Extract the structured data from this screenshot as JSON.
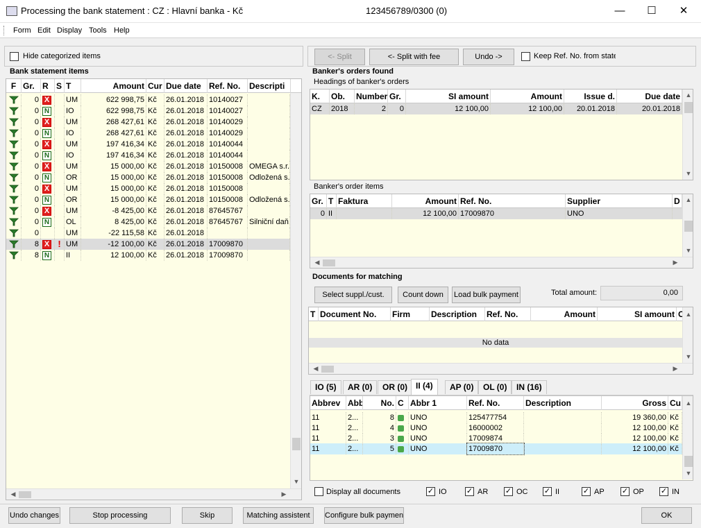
{
  "window": {
    "title": "Processing the bank statement : CZ : Hlavní banka - Kč",
    "account": "123456789/0300 (0)",
    "minimize": "—",
    "maximize": "☐",
    "close": "✕"
  },
  "menu": [
    "Form",
    "Edit",
    "Display",
    "Tools",
    "Help"
  ],
  "left": {
    "hide_categorized": "Hide categorized items",
    "section_title": "Bank statement items",
    "columns": [
      "F",
      "Gr.",
      "R",
      "S",
      "T",
      "Amount",
      "Cur",
      "Due date",
      "Ref. No.",
      "Descripti"
    ],
    "rows": [
      {
        "gr": "0",
        "r": "X",
        "s": "",
        "t": "UM",
        "amount": "622 998,75",
        "cur": "Kč",
        "due": "26.01.2018",
        "ref": "10140027",
        "desc": ""
      },
      {
        "gr": "0",
        "r": "N",
        "s": "",
        "t": "IO",
        "amount": "622 998,75",
        "cur": "Kč",
        "due": "26.01.2018",
        "ref": "10140027",
        "desc": ""
      },
      {
        "gr": "0",
        "r": "X",
        "s": "",
        "t": "UM",
        "amount": "268 427,61",
        "cur": "Kč",
        "due": "26.01.2018",
        "ref": "10140029",
        "desc": ""
      },
      {
        "gr": "0",
        "r": "N",
        "s": "",
        "t": "IO",
        "amount": "268 427,61",
        "cur": "Kč",
        "due": "26.01.2018",
        "ref": "10140029",
        "desc": ""
      },
      {
        "gr": "0",
        "r": "X",
        "s": "",
        "t": "UM",
        "amount": "197 416,34",
        "cur": "Kč",
        "due": "26.01.2018",
        "ref": "10140044",
        "desc": ""
      },
      {
        "gr": "0",
        "r": "N",
        "s": "",
        "t": "IO",
        "amount": "197 416,34",
        "cur": "Kč",
        "due": "26.01.2018",
        "ref": "10140044",
        "desc": ""
      },
      {
        "gr": "0",
        "r": "X",
        "s": "",
        "t": "UM",
        "amount": "15 000,00",
        "cur": "Kč",
        "due": "26.01.2018",
        "ref": "10150008",
        "desc": "OMEGA s.r."
      },
      {
        "gr": "0",
        "r": "N",
        "s": "",
        "t": "OR",
        "amount": "15 000,00",
        "cur": "Kč",
        "due": "26.01.2018",
        "ref": "10150008",
        "desc": "Odložená s."
      },
      {
        "gr": "0",
        "r": "X",
        "s": "",
        "t": "UM",
        "amount": "15 000,00",
        "cur": "Kč",
        "due": "26.01.2018",
        "ref": "10150008",
        "desc": ""
      },
      {
        "gr": "0",
        "r": "N",
        "s": "",
        "t": "OR",
        "amount": "15 000,00",
        "cur": "Kč",
        "due": "26.01.2018",
        "ref": "10150008",
        "desc": "Odložená s."
      },
      {
        "gr": "0",
        "r": "X",
        "s": "",
        "t": "UM",
        "amount": "-8 425,00",
        "cur": "Kč",
        "due": "26.01.2018",
        "ref": "87645767",
        "desc": ""
      },
      {
        "gr": "0",
        "r": "N",
        "s": "",
        "t": "OL",
        "amount": "8 425,00",
        "cur": "Kč",
        "due": "26.01.2018",
        "ref": "87645767",
        "desc": "Silniční daň."
      },
      {
        "gr": "0",
        "r": "",
        "s": "",
        "t": "UM",
        "amount": "-22 115,58",
        "cur": "Kč",
        "due": "26.01.2018",
        "ref": "",
        "desc": ""
      },
      {
        "gr": "8",
        "r": "X",
        "s": "!",
        "t": "UM",
        "amount": "-12 100,00",
        "cur": "Kč",
        "due": "26.01.2018",
        "ref": "17009870",
        "desc": ""
      },
      {
        "gr": "8",
        "r": "N",
        "s": "",
        "t": "II",
        "amount": "12 100,00",
        "cur": "Kč",
        "due": "26.01.2018",
        "ref": "17009870",
        "desc": ""
      }
    ]
  },
  "toolbar": {
    "split": "<- Split",
    "split_fee": "<- Split with fee",
    "undo": "Undo ->",
    "keep_ref": "Keep Ref. No. from state"
  },
  "bankers": {
    "section_title": "Banker's orders found",
    "headings_title": "Headings of banker's orders",
    "head_columns": [
      "K.",
      "Ob.",
      "Number",
      "Gr.",
      "SI amount",
      "Amount",
      "Issue d.",
      "Due date"
    ],
    "head_rows": [
      {
        "k": "CZ",
        "ob": "2018",
        "number": "2",
        "gr": "0",
        "si": "12 100,00",
        "amount": "12 100,00",
        "issue": "20.01.2018",
        "due": "20.01.2018"
      }
    ],
    "items_title": "Banker's order items",
    "item_columns": [
      "Gr.",
      "T",
      "Faktura",
      "Amount",
      "Ref. No.",
      "Supplier",
      "D"
    ],
    "item_rows": [
      {
        "gr": "0",
        "t": "II",
        "faktura": "",
        "amount": "12 100,00",
        "ref": "17009870",
        "supplier": "UNO"
      }
    ]
  },
  "docs": {
    "section_title": "Documents for matching",
    "select_btn": "Select suppl./cust.",
    "count_btn": "Count down",
    "load_btn": "Load bulk payment",
    "total_label": "Total amount:",
    "total_value": "0,00",
    "columns": [
      "T",
      "Document No.",
      "Firm",
      "Description",
      "Ref. No.",
      "Amount",
      "SI amount",
      "C"
    ],
    "no_data": "No data"
  },
  "tabs": [
    {
      "label": "IO (5)",
      "active": false
    },
    {
      "label": "AR (0)",
      "active": false
    },
    {
      "label": "OR (0)",
      "active": false
    },
    {
      "label": "II (4)",
      "active": true
    },
    {
      "label": "AP (0)",
      "active": false
    },
    {
      "label": "OL (0)",
      "active": false
    },
    {
      "label": "IN (16)",
      "active": false
    }
  ],
  "tab_grid": {
    "columns": [
      "Abbrev",
      "Abb",
      "No.",
      "C",
      "Abbr 1",
      "Ref. No.",
      "Description",
      "Gross",
      "Cu"
    ],
    "rows": [
      {
        "abbrev": "11",
        "abb": "2...",
        "no": "8",
        "abbr1": "UNO",
        "ref": "125477754",
        "desc": "",
        "gross": "19 360,00",
        "cu": "Kč"
      },
      {
        "abbrev": "11",
        "abb": "2...",
        "no": "4",
        "abbr1": "UNO",
        "ref": "16000002",
        "desc": "",
        "gross": "12 100,00",
        "cu": "Kč"
      },
      {
        "abbrev": "11",
        "abb": "2...",
        "no": "3",
        "abbr1": "UNO",
        "ref": "17009874",
        "desc": "",
        "gross": "12 100,00",
        "cu": "Kč"
      },
      {
        "abbrev": "11",
        "abb": "2...",
        "no": "5",
        "abbr1": "UNO",
        "ref": "17009870",
        "desc": "",
        "gross": "12 100,00",
        "cu": "Kč"
      }
    ]
  },
  "filters": {
    "display_all": "Display all documents",
    "items": [
      {
        "label": "IO",
        "checked": true
      },
      {
        "label": "AR",
        "checked": true
      },
      {
        "label": "OC",
        "checked": true
      },
      {
        "label": "II",
        "checked": true
      },
      {
        "label": "AP",
        "checked": true
      },
      {
        "label": "OP",
        "checked": true
      },
      {
        "label": "IN",
        "checked": true
      }
    ]
  },
  "footer": {
    "undo_changes": "Undo changes",
    "stop_processing": "Stop processing",
    "skip": "Skip",
    "matching_assistent": "Matching assistent",
    "configure_bulk": "Configure bulk payment",
    "ok": "OK"
  }
}
